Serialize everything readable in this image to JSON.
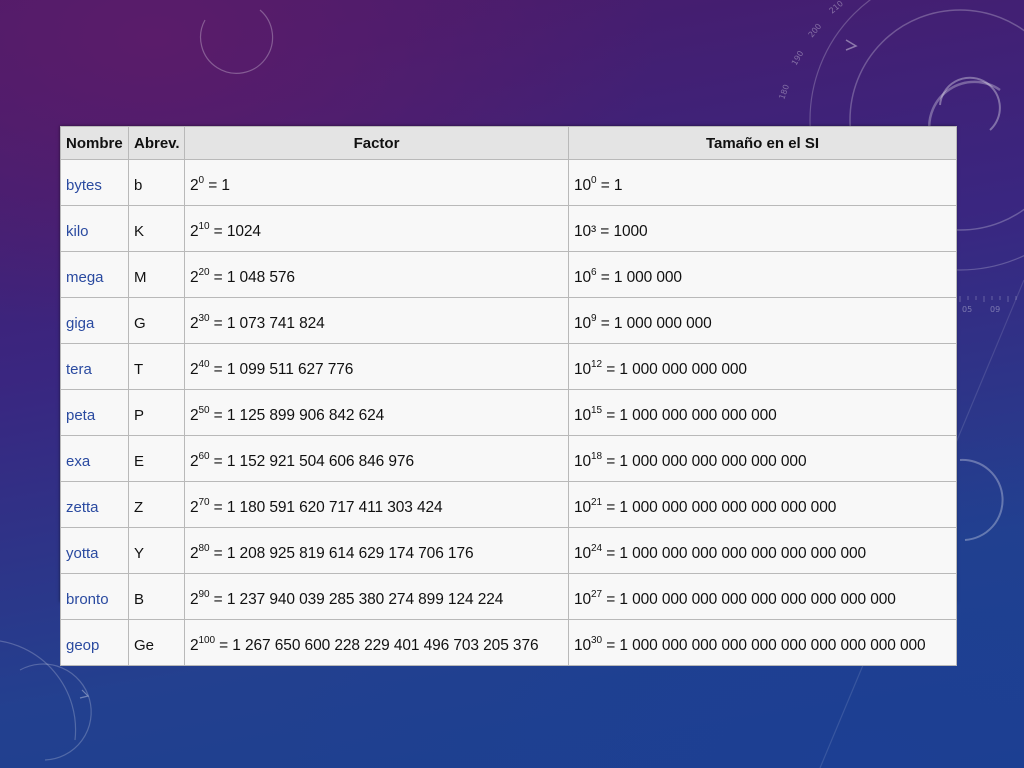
{
  "table": {
    "headers": {
      "name": "Nombre",
      "abbr": "Abrev.",
      "factor": "Factor",
      "si": "Tamaño en el SI"
    },
    "rows": [
      {
        "name": "bytes",
        "abbr": "b",
        "factor_base": "2",
        "factor_exp": "0",
        "factor_value": " = 1",
        "si_base": "10",
        "si_exp": "0",
        "si_value": " = 1"
      },
      {
        "name": "kilo",
        "abbr": "K",
        "factor_base": "2",
        "factor_exp": "10",
        "factor_value": " = 1024",
        "si_base": "10³ = 1000",
        "si_exp": "",
        "si_value": ""
      },
      {
        "name": "mega",
        "abbr": "M",
        "factor_base": "2",
        "factor_exp": "20",
        "factor_value": " = 1 048 576",
        "si_base": "10",
        "si_exp": "6",
        "si_value": " = 1 000 000"
      },
      {
        "name": "giga",
        "abbr": "G",
        "factor_base": "2",
        "factor_exp": "30",
        "factor_value": " = 1 073 741 824",
        "si_base": "10",
        "si_exp": "9",
        "si_value": " = 1 000 000 000"
      },
      {
        "name": "tera",
        "abbr": "T",
        "factor_base": "2",
        "factor_exp": "40",
        "factor_value": " = 1 099 511 627 776",
        "si_base": "10",
        "si_exp": "12",
        "si_value": " = 1 000 000 000 000"
      },
      {
        "name": "peta",
        "abbr": "P",
        "factor_base": "2",
        "factor_exp": "50",
        "factor_value": " = 1 125 899 906 842 624",
        "si_base": "10",
        "si_exp": "15",
        "si_value": " = 1 000 000 000 000 000"
      },
      {
        "name": "exa",
        "abbr": "E",
        "factor_base": "2",
        "factor_exp": "60",
        "factor_value": " = 1 152 921 504 606 846 976",
        "si_base": "10",
        "si_exp": "18",
        "si_value": " = 1 000 000 000 000 000 000"
      },
      {
        "name": "zetta",
        "abbr": "Z",
        "factor_base": "2",
        "factor_exp": "70",
        "factor_value": " = 1 180 591 620 717 411 303 424",
        "si_base": "10",
        "si_exp": "21",
        "si_value": " = 1 000 000 000 000 000 000 000"
      },
      {
        "name": "yotta",
        "abbr": "Y",
        "factor_base": "2",
        "factor_exp": "80",
        "factor_value": " = 1 208 925 819 614 629 174 706 176",
        "si_base": "10",
        "si_exp": "24",
        "si_value": " = 1 000 000 000 000 000 000 000 000"
      },
      {
        "name": "bronto",
        "abbr": "B",
        "factor_base": "2",
        "factor_exp": "90",
        "factor_value": " = 1 237 940 039 285 380 274 899 124 224",
        "si_base": "10",
        "si_exp": "27",
        "si_value": " = 1 000 000 000 000 000 000 000 000 000"
      },
      {
        "name": "geop",
        "abbr": "Ge",
        "factor_base": "2",
        "factor_exp": "100",
        "factor_value": " = 1 267 650 600 228 229 401 496 703 205 376",
        "si_base": "10",
        "si_exp": "30",
        "si_value": " = 1 000 000 000 000 000 000 000 000 000 000"
      }
    ]
  },
  "decoration": {
    "scale_ticks": [
      "180",
      "190",
      "200",
      "210",
      "05",
      "09"
    ]
  }
}
